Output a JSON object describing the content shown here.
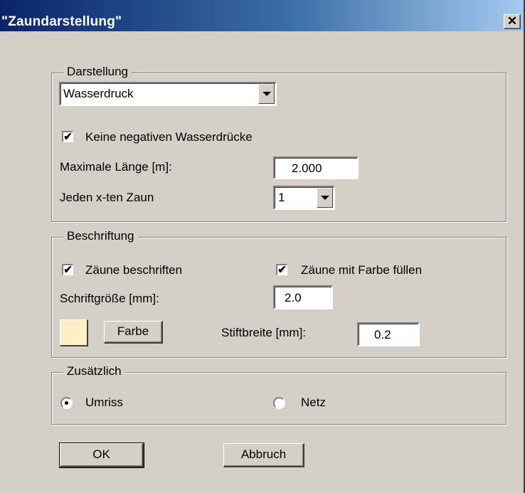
{
  "window": {
    "title": "\"Zaundarstellung\"",
    "close_glyph": "✕"
  },
  "darstellung": {
    "legend": "Darstellung",
    "dropdown_value": "Wasserdruck",
    "checkbox_label": "Keine negativen Wasserdrücke",
    "checkbox_checked": true,
    "max_len_label": "Maximale Länge [m]:",
    "max_len_value": "2.000",
    "nth_label": "Jeden x-ten Zaun",
    "nth_value": "1"
  },
  "beschriftung": {
    "legend": "Beschriftung",
    "cb_label_label": "Zäune beschriften",
    "cb_label_checked": true,
    "cb_fill_label": "Zäune mit Farbe füllen",
    "cb_fill_checked": true,
    "font_label": "Schriftgröße [mm]:",
    "font_value": "2.0",
    "color_button": "Farbe",
    "swatch_color": "#fdefc6",
    "pen_label": "Stiftbreite [mm]:",
    "pen_value": "0.2"
  },
  "zusaetzlich": {
    "legend": "Zusätzlich",
    "radio_umriss": "Umriss",
    "radio_netz": "Netz",
    "selected": "Umriss"
  },
  "buttons": {
    "ok": "OK",
    "cancel": "Abbruch"
  }
}
